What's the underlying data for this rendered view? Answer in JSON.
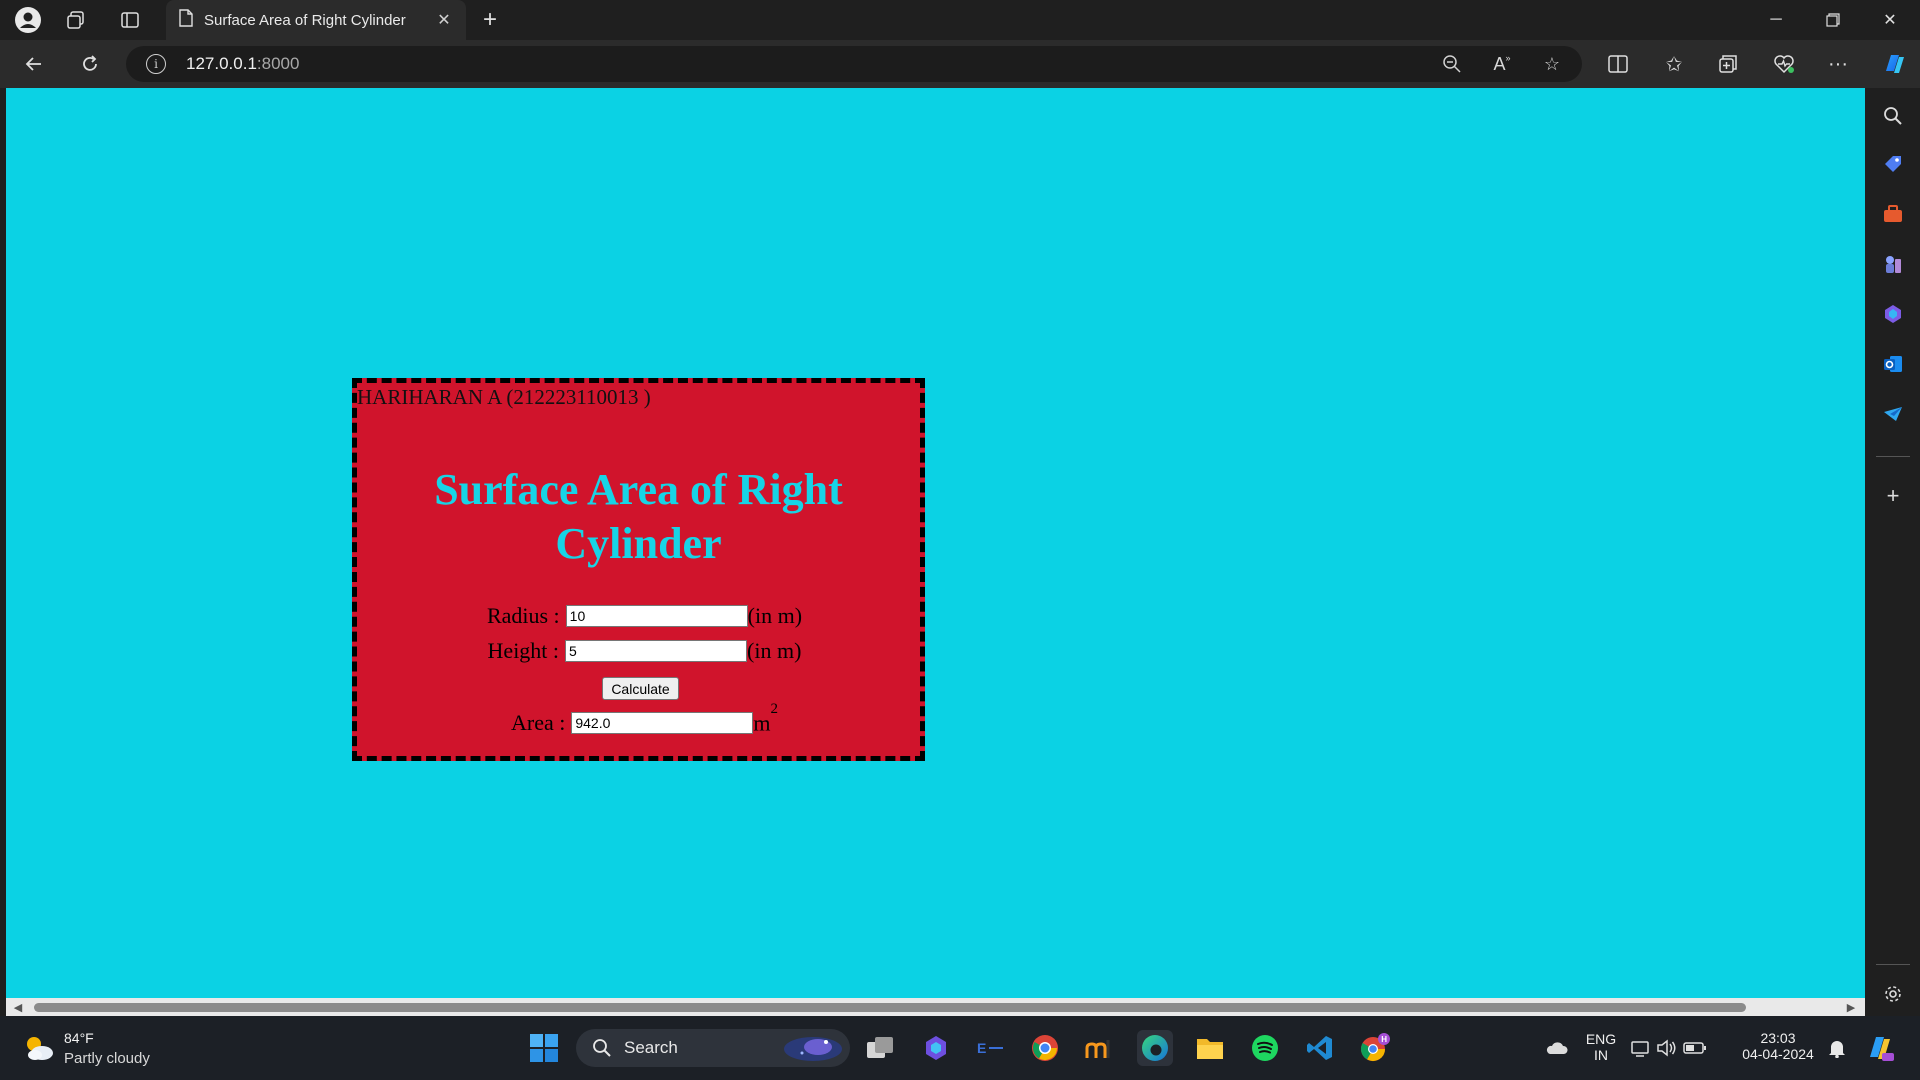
{
  "browser": {
    "tab": {
      "title": "Surface Area of Right Cylinder"
    },
    "url": {
      "host": "127.0.0.1",
      "port": ":8000"
    }
  },
  "page": {
    "student": "HARIHARAN A (212223110013 )",
    "heading": "Surface Area of Right Cylinder",
    "radius": {
      "label": "Radius :",
      "value": "10",
      "unit": "(in m)"
    },
    "height": {
      "label": "Height :",
      "value": "5",
      "unit": "(in m)"
    },
    "calculate_label": "Calculate",
    "area": {
      "label": "Area :",
      "value": "942.0",
      "unit": "m",
      "unit_sup": "2"
    },
    "colors": {
      "background": "#0bd2e4",
      "card": "#d0142c",
      "heading": "#17d4e6"
    }
  },
  "taskbar": {
    "weather": {
      "temp": "84°F",
      "desc": "Partly cloudy"
    },
    "search_label": "Search",
    "lang": {
      "line1": "ENG",
      "line2": "IN"
    },
    "clock": {
      "time": "23:03",
      "date": "04-04-2024"
    }
  }
}
